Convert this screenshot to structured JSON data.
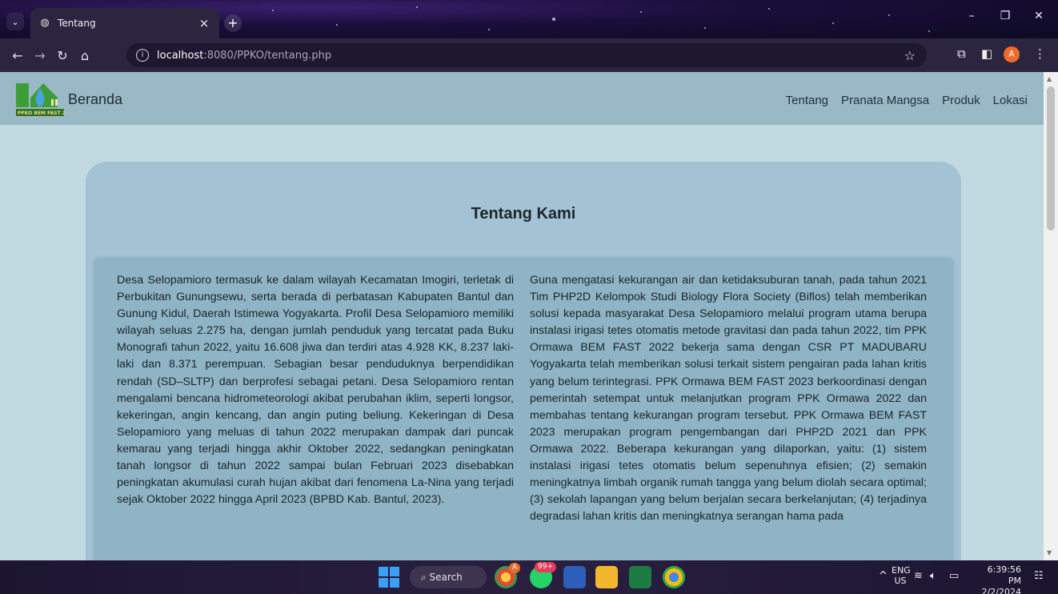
{
  "browser": {
    "tab_title": "Tentang",
    "url_host": "localhost",
    "url_path": ":8080/PPKO/tentang.php",
    "profile_initial": "A"
  },
  "site": {
    "logo_text": "PPKO BEM FAST 2023",
    "brand": "Beranda",
    "nav": [
      "Tentang",
      "Pranata Mangsa",
      "Produk",
      "Lokasi"
    ]
  },
  "content": {
    "heading": "Tentang Kami",
    "left_paragraph": "Desa Selopamioro termasuk ke dalam wilayah Kecamatan Imogiri, terletak di Perbukitan Gunungsewu, serta berada di perbatasan Kabupaten Bantul dan Gunung Kidul, Daerah Istimewa Yogyakarta. Profil Desa Selopamioro memiliki wilayah seluas 2.275 ha, dengan jumlah penduduk yang tercatat pada Buku Monografi tahun 2022, yaitu 16.608 jiwa dan terdiri atas 4.928 KK, 8.237 laki-laki dan 8.371 perempuan. Sebagian besar penduduknya berpendidikan rendah (SD–SLTP) dan berprofesi sebagai petani. Desa Selopamioro rentan mengalami bencana hidrometeorologi akibat perubahan iklim, seperti longsor, kekeringan, angin kencang, dan angin puting beliung. Kekeringan di Desa Selopamioro yang meluas di tahun 2022 merupakan dampak dari puncak kemarau yang terjadi hingga akhir Oktober 2022, sedangkan peningkatan tanah longsor di tahun 2022 sampai bulan Februari 2023 disebabkan peningkatan akumulasi curah hujan akibat dari fenomena La-Nina yang terjadi sejak Oktober 2022 hingga April 2023 (BPBD Kab. Bantul, 2023).",
    "right_paragraph": "Guna mengatasi kekurangan air dan ketidaksuburan tanah, pada tahun 2021 Tim PHP2D Kelompok Studi Biology Flora Society (Biflos) telah memberikan solusi kepada masyarakat Desa Selopamioro melalui program utama berupa instalasi irigasi tetes otomatis metode gravitasi dan pada tahun 2022, tim PPK Ormawa BEM FAST 2022 bekerja sama dengan CSR PT MADUBARU Yogyakarta telah memberikan solusi terkait sistem pengairan pada lahan kritis yang belum terintegrasi. PPK Ormawa BEM FAST 2023 berkoordinasi dengan pemerintah setempat untuk melanjutkan program PPK Ormawa 2022 dan membahas tentang kekurangan program tersebut. PPK Ormawa BEM FAST 2023 merupakan program pengembangan dari PHP2D 2021 dan PPK Ormawa 2022. Beberapa kekurangan yang dilaporkan, yaitu: (1) sistem instalasi irigasi tetes otomatis belum sepenuhnya efisien; (2) semakin meningkatnya limbah organik rumah tangga yang belum diolah secara optimal; (3) sekolah lapangan yang belum berjalan secara berkelanjutan; (4) terjadinya degradasi lahan kritis dan meningkatnya serangan hama pada"
  },
  "taskbar": {
    "search_label": "Search",
    "whatsapp_badge": "99+",
    "lang_primary": "ENG",
    "lang_secondary": "US",
    "time": "6:39:56 PM",
    "date": "2/2/2024"
  },
  "colors": {
    "navbar": "#99b9c7",
    "page_bg": "#c1d9e1",
    "card": "#a3c2d4",
    "inner": "#8fb4c5"
  }
}
